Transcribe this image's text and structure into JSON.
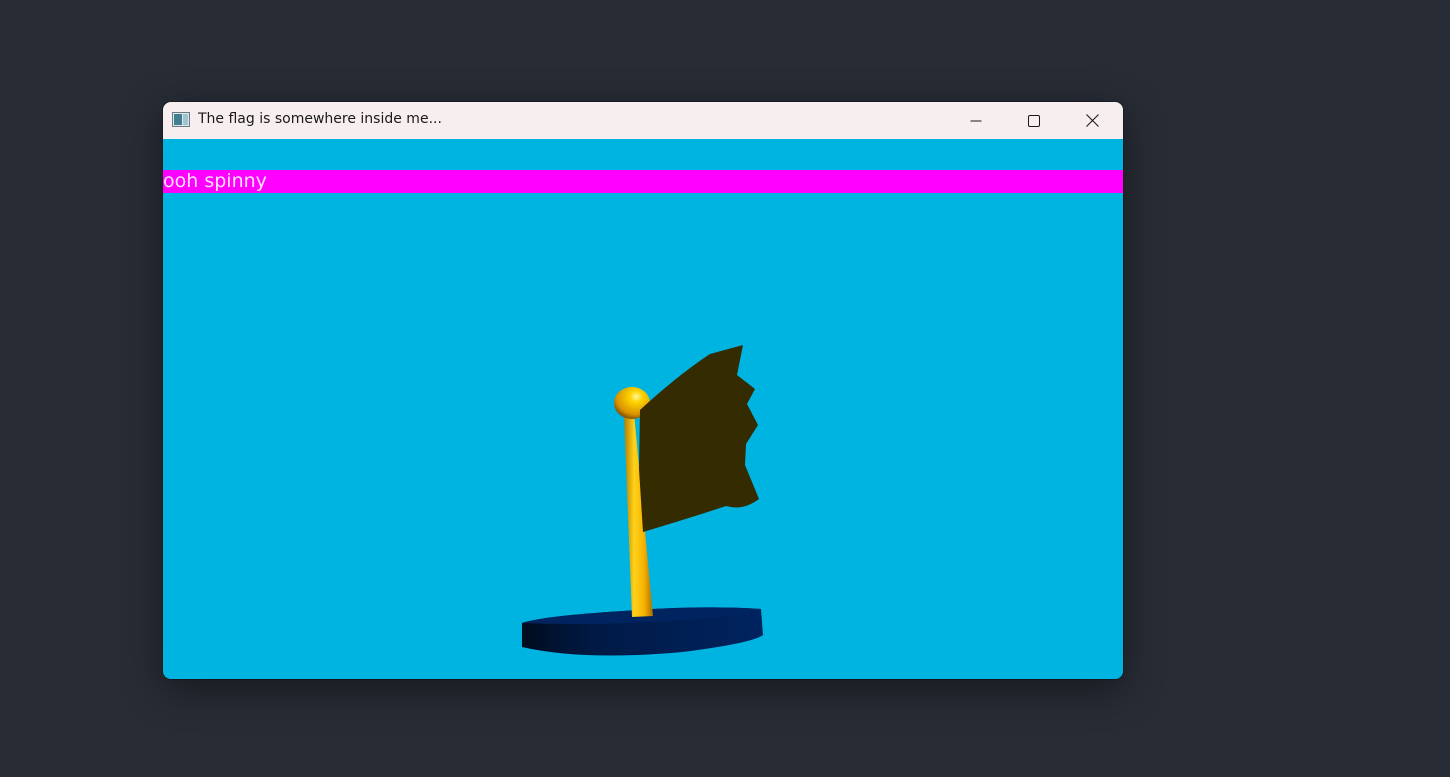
{
  "window": {
    "title": "The flag is somewhere inside me...",
    "controls": {
      "minimize_icon": "minimize-icon",
      "maximize_icon": "maximize-icon",
      "close_icon": "close-icon"
    }
  },
  "banner": {
    "text": "ooh spinny"
  },
  "colors": {
    "desktop_background": "#282c35",
    "titlebar_background": "#f7efef",
    "viewport_background": "#00b4e2",
    "banner_background": "#ff00ff",
    "banner_text": "#ffe2ff",
    "flag_cloth": "#352b00",
    "pole_gold": "#f5b800",
    "base_navy": "#00215a"
  }
}
